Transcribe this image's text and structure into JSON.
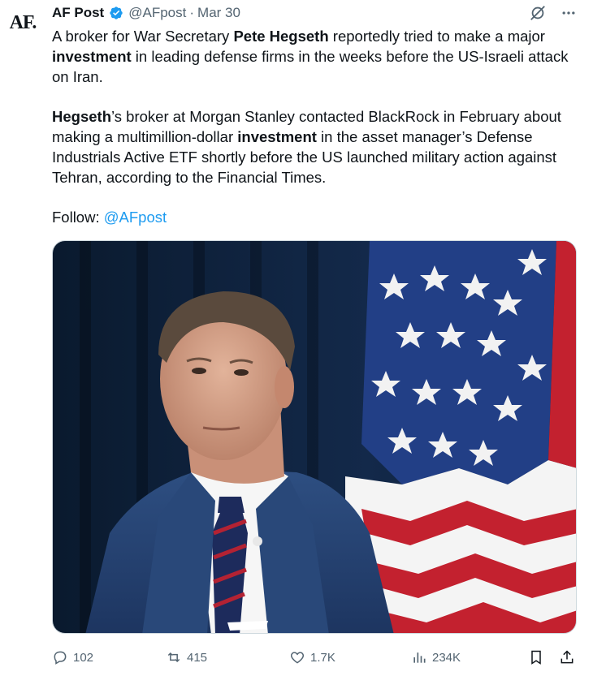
{
  "author": {
    "avatar_text": "AF.",
    "name": "AF Post",
    "handle": "@AFpost",
    "separator": "·",
    "date": "Mar 30"
  },
  "post": {
    "p1": {
      "t1": "A broker for War Secretary ",
      "b1": "Pete Hegseth",
      "t2": " reportedly tried to make a major ",
      "b2": "investment",
      "t3": " in leading defense firms in the weeks before the US-Israeli attack on Iran."
    },
    "p2": {
      "b1": "Hegseth",
      "t1": "’s broker at Morgan Stanley contacted BlackRock in February about making a multimillion-dollar ",
      "b2": "investment",
      "t2": " in the asset manager’s Defense Industrials Active ETF shortly before the US launched military action against Tehran, according to the Financial Times."
    },
    "p3": {
      "label": "Follow: ",
      "link": "@AFpost"
    }
  },
  "stats": {
    "replies": "102",
    "reposts": "415",
    "likes": "1.7K",
    "views": "234K"
  },
  "icons": {
    "verified": "verified-badge-icon",
    "grok": "grok-icon",
    "more": "more-icon",
    "reply": "reply-icon",
    "repost": "repost-icon",
    "like": "like-icon",
    "views": "views-icon",
    "bookmark": "bookmark-icon",
    "share": "share-icon"
  },
  "colors": {
    "text": "#0f1419",
    "secondary": "#536471",
    "link": "#1d9bf0",
    "verified": "#1d9bf0"
  }
}
